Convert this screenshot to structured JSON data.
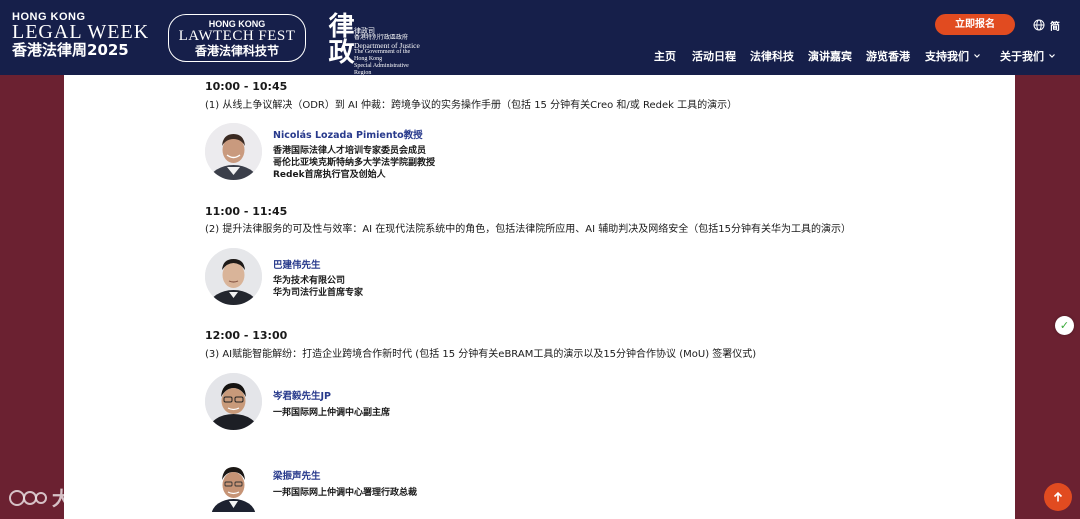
{
  "header": {
    "logo_hklw": {
      "line1": "HONG KONG",
      "line2": "LEGAL WEEK",
      "line3": "香港法律周2025"
    },
    "logo_fest": {
      "line1": "HONG KONG",
      "line2": "LAWTECH FEST",
      "line3": "香港法律科技节"
    },
    "logo_doj": {
      "seal": "律政",
      "cn": "律政司",
      "cn_sub": "香港特別行政區政府",
      "en": "Department of Justice",
      "en_sub1": "The Government of the Hong Kong",
      "en_sub2": "Special Administrative Region"
    },
    "register_button": "立即报名",
    "language": "简",
    "nav": [
      {
        "label": "主页"
      },
      {
        "label": "活动日程"
      },
      {
        "label": "法律科技"
      },
      {
        "label": "演讲嘉宾"
      },
      {
        "label": "游览香港"
      },
      {
        "label": "支持我们"
      },
      {
        "label": "关于我们"
      }
    ]
  },
  "sessions": [
    {
      "time": "10:00 - 10:45",
      "title": "(1) 从线上争议解决（ODR）到 AI 仲裁：跨境争议的实务操作手册（包括 15 分钟有关Creo 和/或 Redek 工具的演示）",
      "speakers": [
        {
          "name": "Nicolás Lozada Pimiento教授",
          "lines": [
            "香港国际法律人才培训专家委员会成员",
            "哥伦比亚埃克斯特纳多大学法学院副教授",
            "Redek首席执行官及创始人"
          ]
        }
      ]
    },
    {
      "time": "11:00 - 11:45",
      "title": "(2) 提升法律服务的可及性与效率：AI 在现代法院系统中的角色，包括法律院所应用、AI 辅助判决及网络安全（包括15分钟有关华为工具的演示）",
      "speakers": [
        {
          "name": "巴建伟先生",
          "lines": [
            "华为技术有限公司",
            "华为司法行业首席专家"
          ]
        }
      ]
    },
    {
      "time": "12:00 - 13:00",
      "title": "(3) AI赋能智能解纷：打造企业跨境合作新时代 (包括 15 分钟有关eBRAM工具的演示以及15分钟合作协议 (MoU) 签署仪式)",
      "speakers": [
        {
          "name": "岑君毅先生JP",
          "lines": [
            "一邦国际网上仲调中心副主席"
          ]
        },
        {
          "name": "梁振声先生",
          "lines": [
            "一邦国际网上仲调中心署理行政总裁"
          ]
        }
      ]
    }
  ],
  "watermark": "大数跨境",
  "colors": {
    "header_bg": "#161f4a",
    "page_bg": "#6b2131",
    "accent": "#e14b20",
    "speaker_name": "#283a8c"
  }
}
